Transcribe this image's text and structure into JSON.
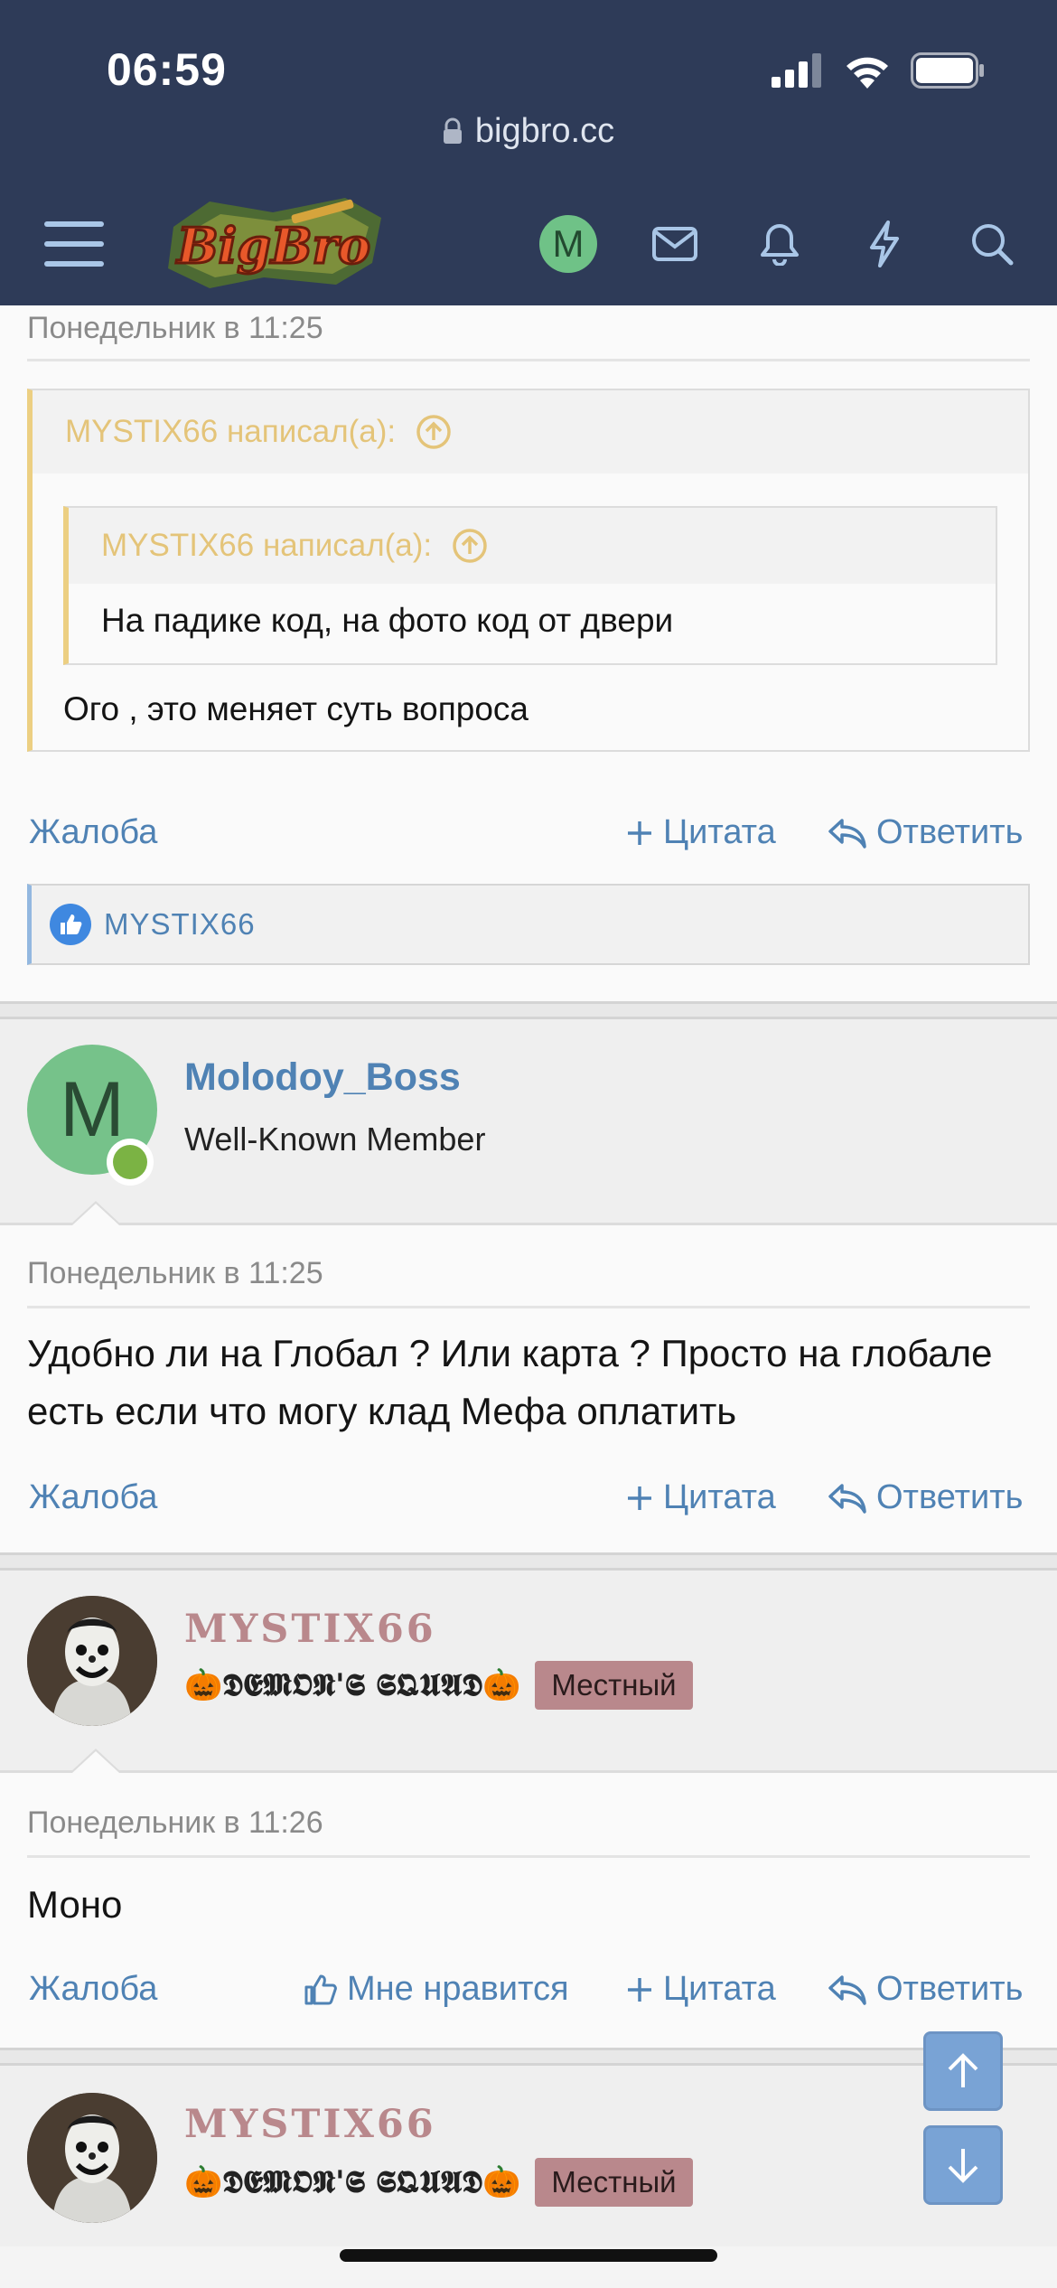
{
  "status": {
    "time": "06:59"
  },
  "browser": {
    "url": "bigbro.cc"
  },
  "nav": {
    "logo_text": "BigBro",
    "avatar_letter": "M"
  },
  "posts": [
    {
      "date": "Понедельник в 11:25",
      "quote_outer": {
        "author": "MYSTIX66 написал(а):",
        "text": "Ого , это меняет суть вопроса"
      },
      "quote_inner": {
        "author": "MYSTIX66 написал(а):",
        "text": "На падике код, на фото код от двери"
      },
      "actions": {
        "report": "Жалоба",
        "quote": "Цитата",
        "reply": "Ответить"
      },
      "likes": "MYSTIX66"
    },
    {
      "user": {
        "name": "Molodoy_Boss",
        "title": "Well-Known Member",
        "avatar_letter": "M"
      },
      "date": "Понедельник в 11:25",
      "text": "Удобно ли на Глобал ? Или карта ? Просто на глобале есть если что могу клад Мефа оплатить",
      "actions": {
        "report": "Жалоба",
        "quote": "Цитата",
        "reply": "Ответить"
      }
    },
    {
      "user": {
        "name": "MYSTIX66",
        "title": "🎃𝕯𝕰𝕸𝕺𝕹'𝕾 𝕾𝕼𝖀𝕬𝕯🎃",
        "badge": "Местный"
      },
      "date": "Понедельник в 11:26",
      "text": "Моно",
      "actions": {
        "report": "Жалоба",
        "like": "Мне нравится",
        "quote": "Цитата",
        "reply": "Ответить"
      }
    },
    {
      "user": {
        "name": "MYSTIX66",
        "title": "🎃𝕯𝕰𝕸𝕺𝕹'𝕾 𝕾𝕼𝖀𝕬𝕯🎃",
        "badge": "Местный"
      }
    }
  ],
  "colors": {
    "header_bg": "#2e3b58",
    "link": "#4f82b4",
    "quote_accent": "#eccf82",
    "mystix_name": "#b9888c",
    "fab": "#79a3d5"
  },
  "icons": [
    "menu-icon",
    "mail-icon",
    "bell-icon",
    "lightning-icon",
    "search-icon",
    "lock-icon",
    "plus-icon",
    "reply-icon",
    "thumbs-up-icon",
    "arrow-up-icon",
    "arrow-down-icon",
    "up-circle-icon"
  ]
}
